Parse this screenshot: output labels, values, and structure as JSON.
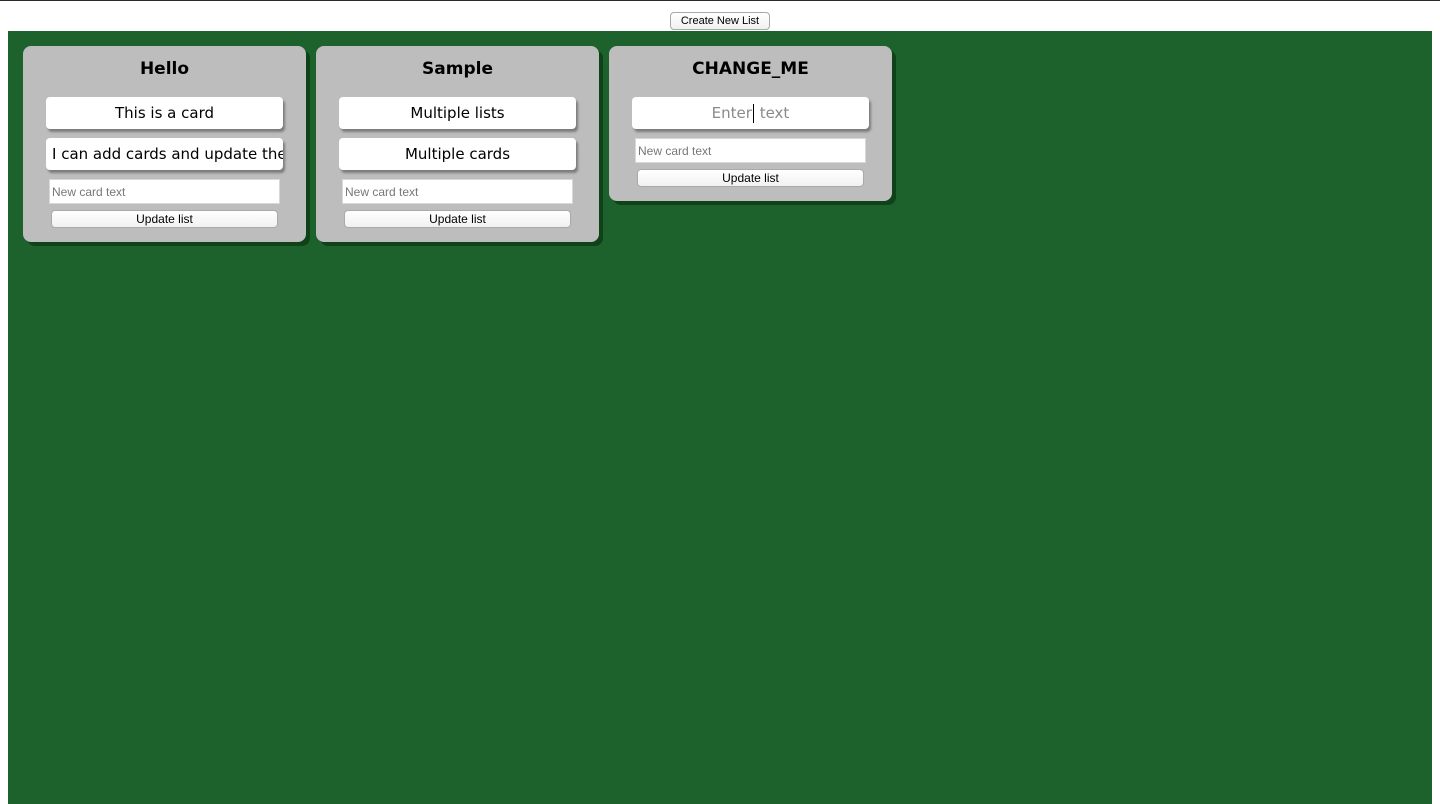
{
  "toolbar": {
    "create_label": "Create New List"
  },
  "lists": [
    {
      "title": "Hello",
      "cards": [
        "This is a card",
        "I can add cards and update the"
      ],
      "new_card_placeholder": "New card text",
      "update_label": "Update list"
    },
    {
      "title": "Sample",
      "cards": [
        "Multiple lists",
        "Multiple cards"
      ],
      "new_card_placeholder": "New card text",
      "update_label": "Update list"
    },
    {
      "title": "CHANGE_ME",
      "editing_card": {
        "text_before_caret": "Enter",
        "text_after_caret": " text"
      },
      "new_card_placeholder": "New card text",
      "update_label": "Update list"
    }
  ],
  "colors": {
    "board_background": "#1d622d",
    "list_background": "#bdbdbd",
    "list_shadow": "#0f4219"
  }
}
